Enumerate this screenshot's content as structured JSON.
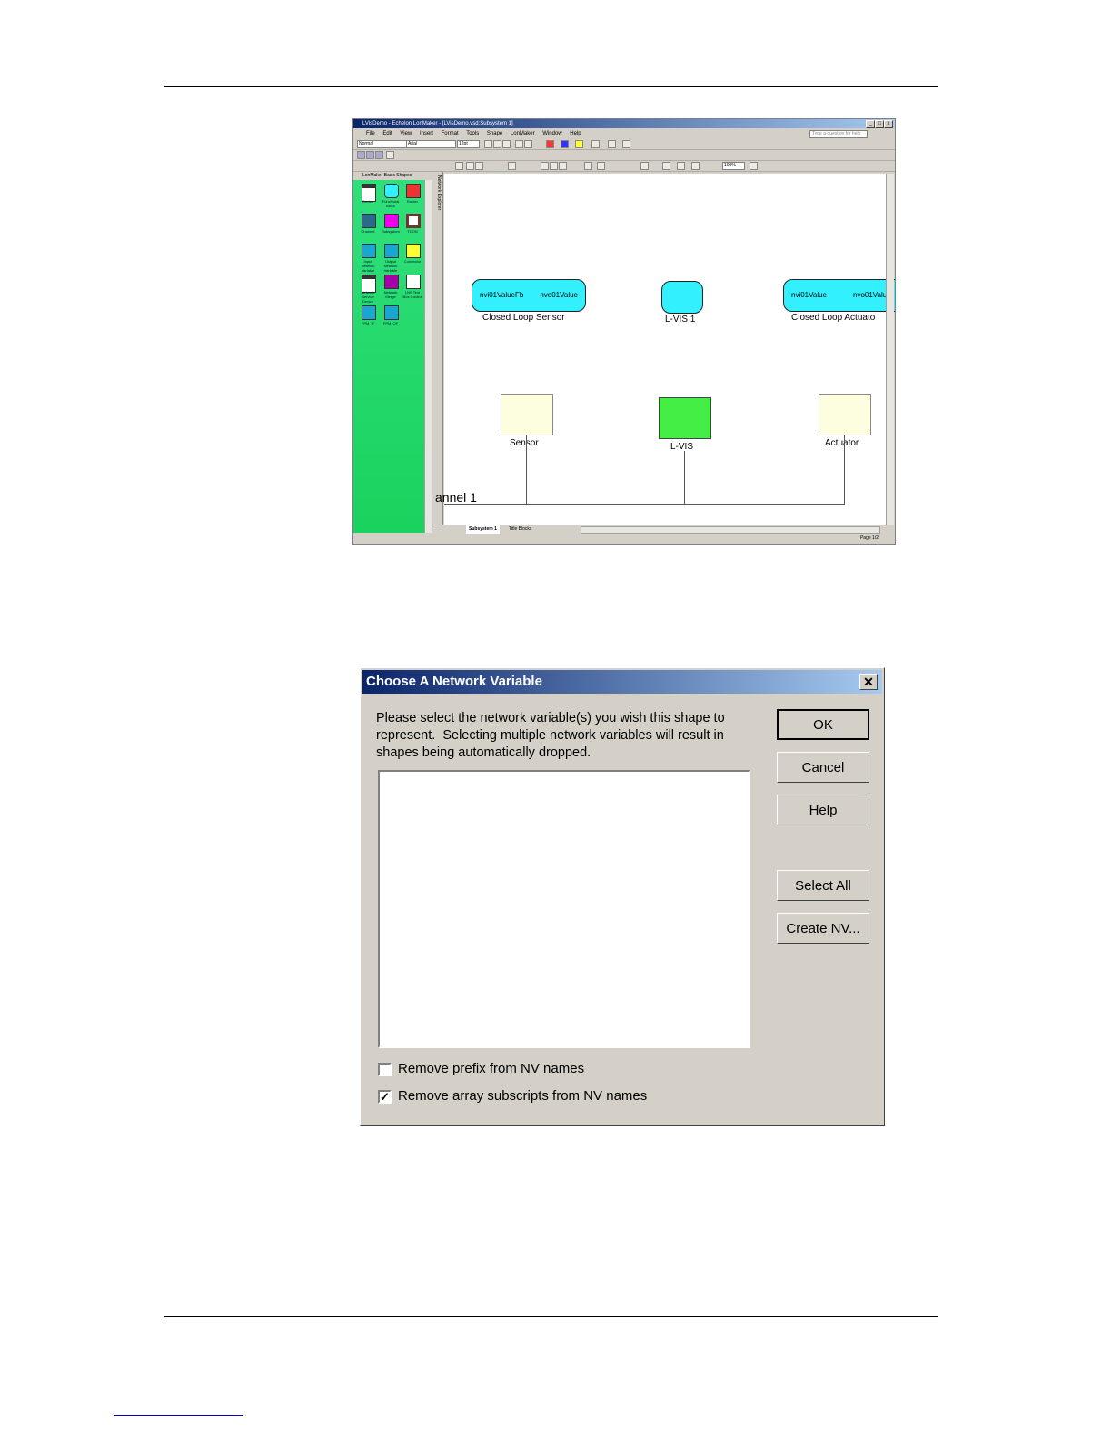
{
  "window": {
    "title": "LVisDemo - Echelon LonMaker - [LVisDemo.vsd:Subsystem 1]",
    "menu": [
      "File",
      "Edit",
      "View",
      "Insert",
      "Format",
      "Tools",
      "Shape",
      "LonMaker",
      "Window",
      "Help"
    ],
    "help_placeholder": "Type a question for help",
    "style_value": "Normal",
    "font_value": "Arial",
    "size_value": "12pt",
    "zoom_value": "100%",
    "stencil_title": "LonMaker Basic Shapes",
    "network_explorer_label": "Network Explorer",
    "stencil_items": [
      "Device",
      "Functional Block",
      "Router",
      "Channel",
      "Subsystem",
      "TCON",
      "Input Network Variable",
      "Output Network Variable",
      "Connector",
      "Network Service Device",
      "Network Merge",
      "LNS Text Box Control",
      "FPM_IF",
      "FPM_OF"
    ],
    "sheet_tabs": [
      "Subsystem 1",
      "Title Blocks"
    ],
    "page_status": "Page 1/2"
  },
  "canvas": {
    "blocks": [
      {
        "label": "Closed Loop Sensor",
        "input": "nvi01ValueFb",
        "output": "nvo01Value"
      },
      {
        "label": "L-VIS 1",
        "input": "",
        "output": ""
      },
      {
        "label": "Closed Loop Actuato",
        "input": "nvi01Value",
        "output": "nvo01Valu"
      }
    ],
    "devices": [
      "Sensor",
      "L-VIS",
      "Actuator"
    ],
    "device_colors": {
      "sensor": "#fdfde0",
      "lvis": "#44ee44",
      "actuator": "#fdfde0"
    },
    "channel_label": "annel 1"
  },
  "dialog": {
    "title": "Choose A Network Variable",
    "prompt_lines": [
      "Please select the network variable(s) you wish this shape to",
      "represent.  Selecting multiple network variables will result in",
      "shapes being automatically dropped."
    ],
    "buttons": {
      "ok": "OK",
      "cancel": "Cancel",
      "help": "Help",
      "select_all": "Select All",
      "create_nv": "Create NV..."
    },
    "checkboxes": [
      {
        "label": "Remove prefix from NV names",
        "checked": false
      },
      {
        "label": "Remove array subscripts from NV names",
        "checked": true
      }
    ]
  }
}
